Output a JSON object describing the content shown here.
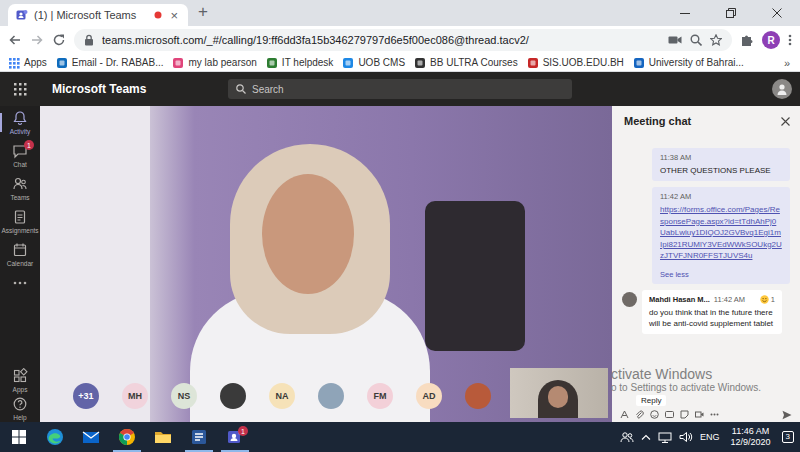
{
  "browser": {
    "tabs": [
      {
        "label": "(1) | Microsoft Teams",
        "selected": true,
        "recording": true,
        "close": "×"
      }
    ],
    "new_tab": "+",
    "address": {
      "url": "teams.microsoft.com/_#/calling/19:ff6dd3fa15b346279797d6e5f00ec086@thread.tacv2/"
    },
    "profile": "R",
    "bookmarks": [
      {
        "label": "Apps",
        "kind": "apps",
        "color": "#4285f4"
      },
      {
        "label": "Email - Dr. RABAB...",
        "kind": "link",
        "color": "#0f6cbd"
      },
      {
        "label": "my lab pearson",
        "kind": "link",
        "color": "#e0457b"
      },
      {
        "label": "IT helpdesk",
        "kind": "link",
        "color": "#2e7d32"
      },
      {
        "label": "UOB CMS",
        "kind": "link",
        "color": "#1e88e5"
      },
      {
        "label": "BB ULTRA Courses",
        "kind": "link",
        "color": "#333333"
      },
      {
        "label": "SIS.UOB.EDU.BH",
        "kind": "link",
        "color": "#c62828"
      },
      {
        "label": "University of Bahrai...",
        "kind": "link",
        "color": "#1565c0"
      }
    ],
    "bookmarks_more": "»"
  },
  "teams": {
    "title": "Microsoft Teams",
    "search": {
      "placeholder": "Search"
    }
  },
  "rail": {
    "items": [
      {
        "label": "Activity",
        "kind": "activity",
        "selected": true
      },
      {
        "label": "Chat",
        "kind": "chat",
        "selected": false,
        "badge": "1"
      },
      {
        "label": "Teams",
        "kind": "teams",
        "selected": false
      },
      {
        "label": "Assignments",
        "kind": "assignments",
        "selected": false
      },
      {
        "label": "Calendar",
        "kind": "calendar",
        "selected": false
      }
    ],
    "footer_items": [
      {
        "label": "Apps",
        "kind": "apps",
        "selected": false
      },
      {
        "label": "Help",
        "kind": "help",
        "selected": false
      }
    ]
  },
  "call": {
    "participants": [
      {
        "kind": "count",
        "label": "+31",
        "color": "#6264a7"
      },
      {
        "kind": "initials",
        "label": "MH",
        "color": "#f1d3dc"
      },
      {
        "kind": "initials",
        "label": "NS",
        "color": "#dde5d8"
      },
      {
        "kind": "photo",
        "color": "#3a3a3a"
      },
      {
        "kind": "initials",
        "label": "NA",
        "color": "#f6e2b8"
      },
      {
        "kind": "photo",
        "color": "#8fa4b8"
      },
      {
        "kind": "initials",
        "label": "FM",
        "color": "#f3d0d8"
      },
      {
        "kind": "initials",
        "label": "AD",
        "color": "#f8dcc0"
      },
      {
        "kind": "photo",
        "color": "#b85a3a"
      }
    ]
  },
  "chat": {
    "title": "Meeting chat",
    "messages": [
      {
        "kind": "sent",
        "time": "11:38 AM",
        "text": "OTHER QUESTIONS PLEASE"
      },
      {
        "kind": "sent-link",
        "time": "11:42 AM",
        "link": "https://forms.office.com/Pages/ResponsePage.aspx?id=tTdhAhPj0UabLwiuy1DIQOJ2GVBvq1Egi1mIpi821RUMlY3VEdWWkSOUkg2UzJTVFJNR0FFSTJUVS4u",
        "toggle": "See less"
      },
      {
        "kind": "received",
        "author": "Mahdi Hasan M...",
        "time": "11:42 AM",
        "reaction": "1",
        "text": "do you think that in the future there will be anti-covid supplement tablet"
      }
    ],
    "reply": "Reply"
  },
  "watermark": {
    "lines": [
      "ctivate Windows",
      "o to Settings to activate Windows."
    ]
  },
  "taskbar": {
    "apps": [
      {
        "kind": "edge",
        "running": false
      },
      {
        "kind": "mail",
        "running": false
      },
      {
        "kind": "chrome",
        "running": true
      },
      {
        "kind": "explorer",
        "running": false
      },
      {
        "kind": "word",
        "running": true
      },
      {
        "kind": "teams",
        "running": true,
        "badge": "1"
      }
    ],
    "tray": {
      "language": "ENG",
      "time": "11:46 AM",
      "date": "12/9/2020",
      "notifications": "3"
    }
  }
}
